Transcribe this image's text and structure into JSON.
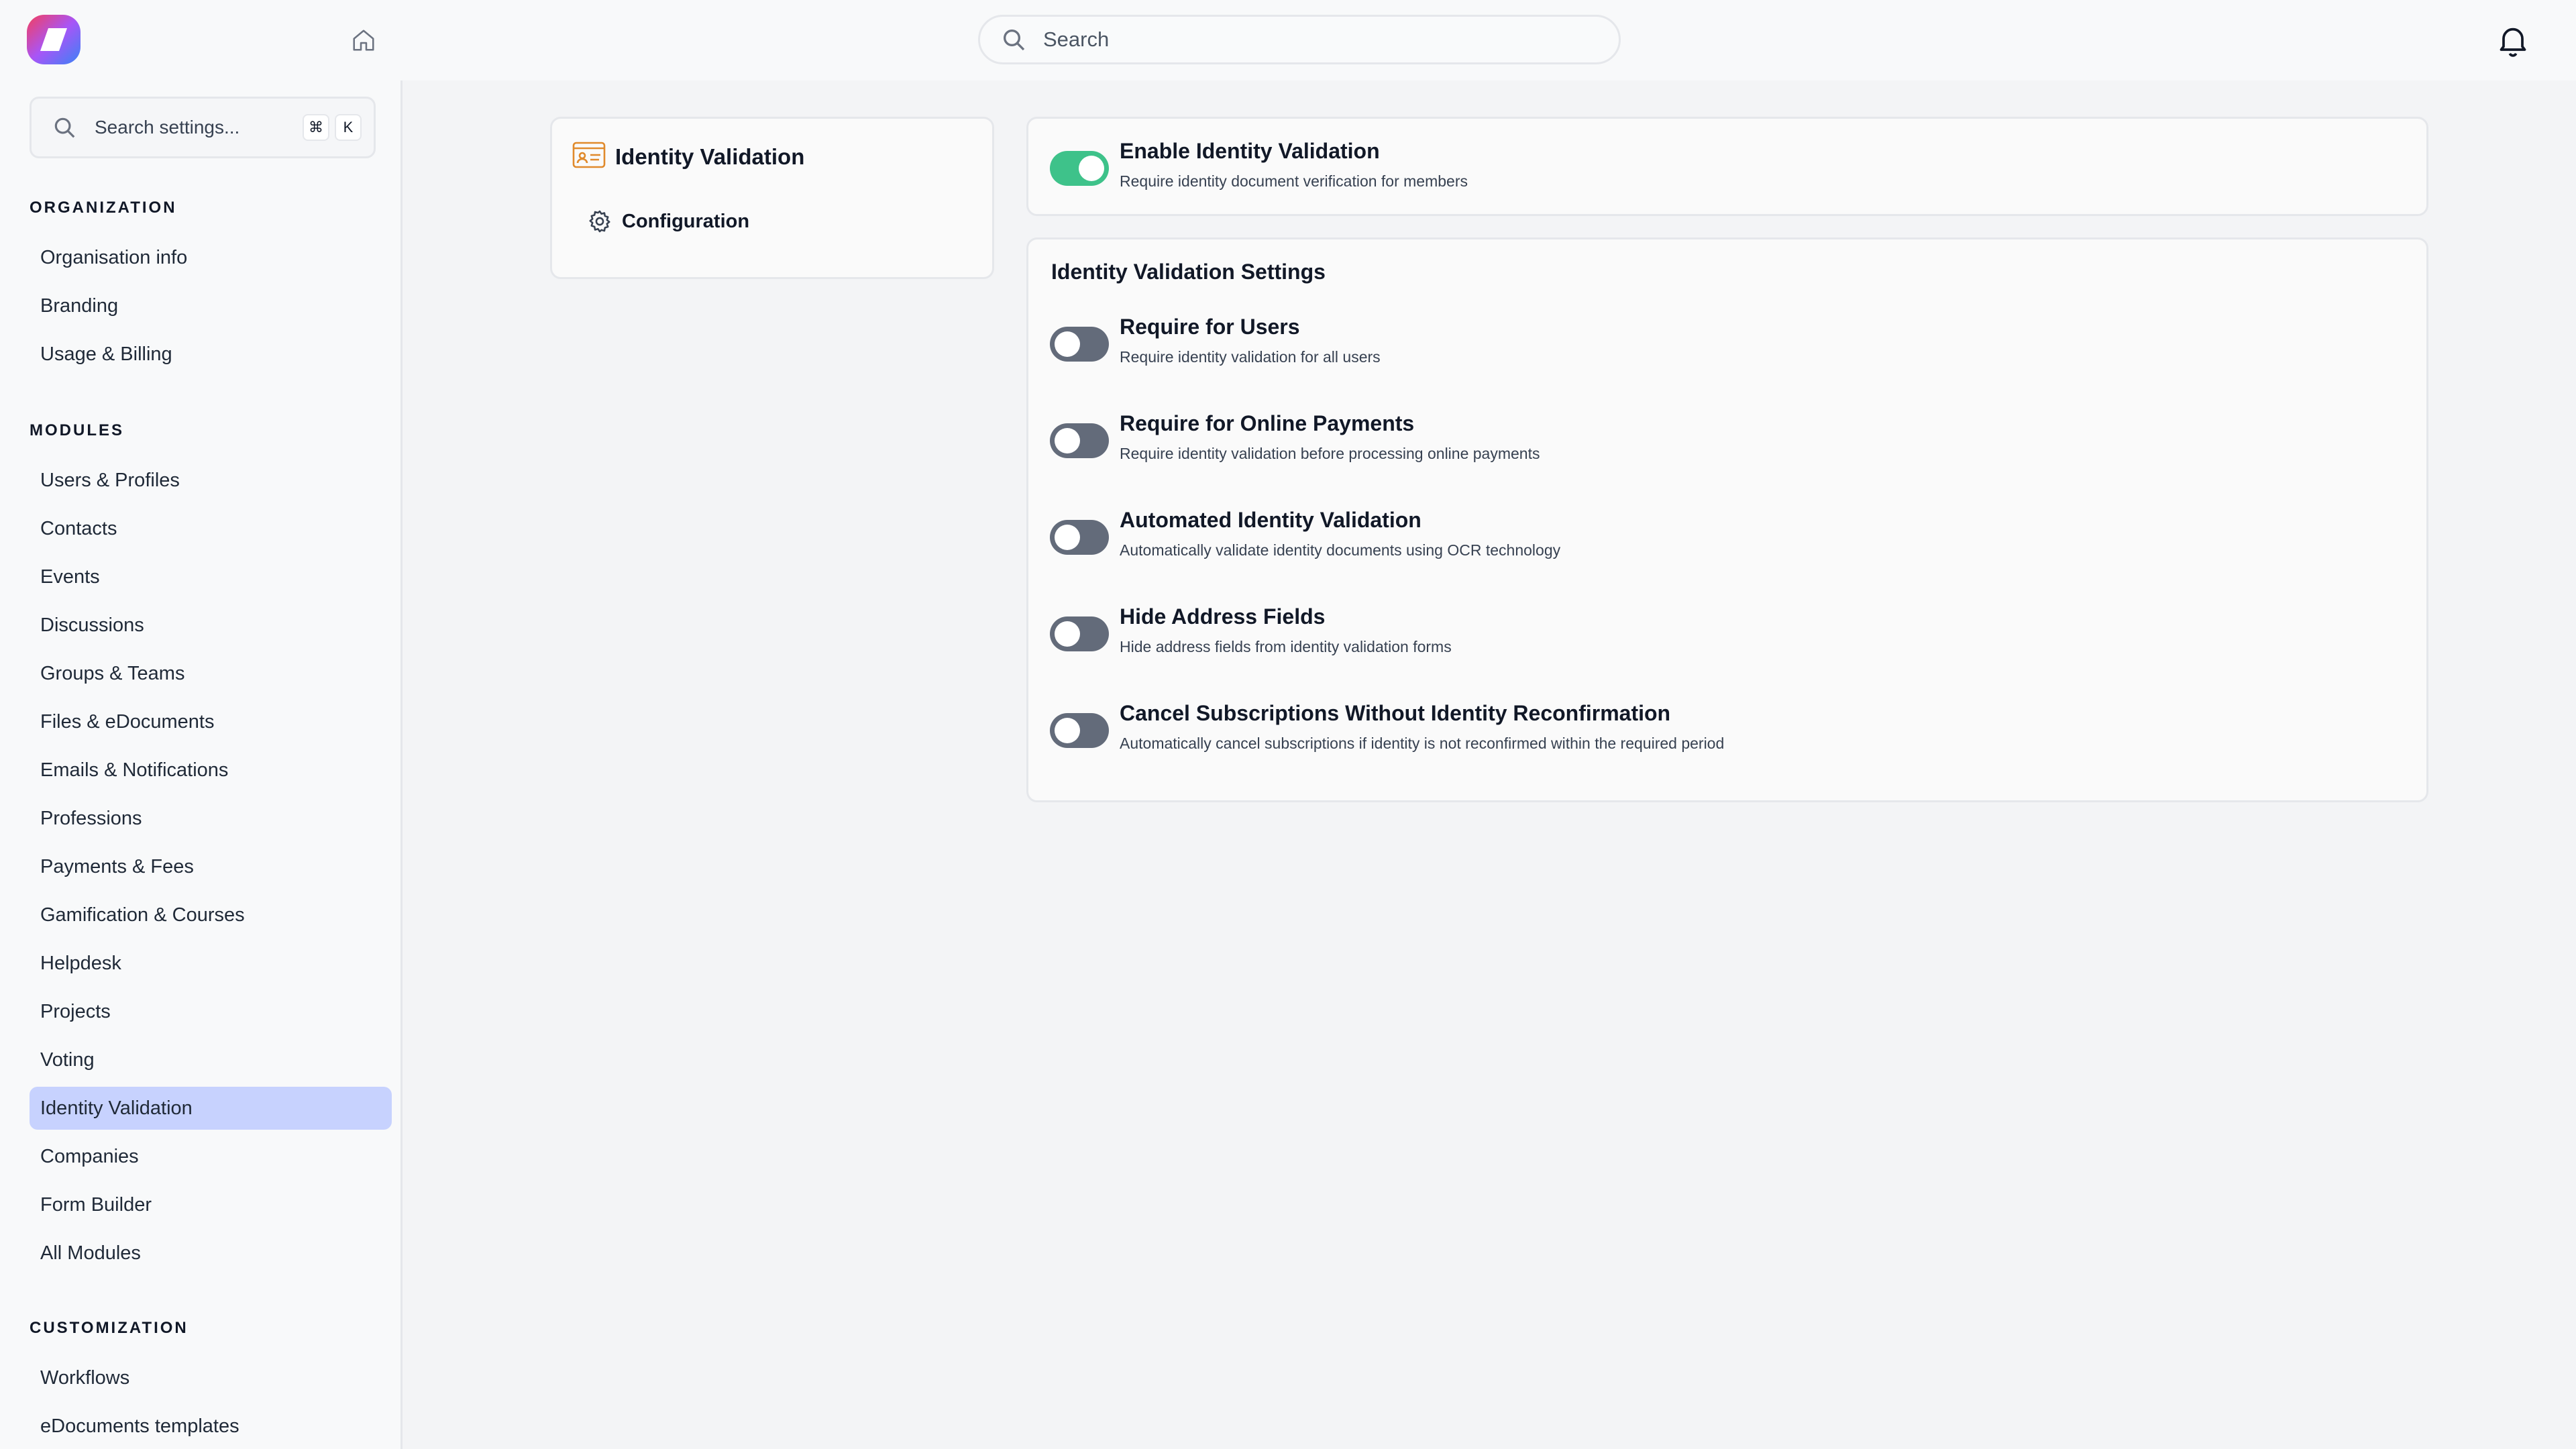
{
  "topbar": {
    "search_placeholder": "Search"
  },
  "sidebar": {
    "search_placeholder": "Search settings...",
    "shortcut": [
      "⌘",
      "K"
    ],
    "sections": [
      {
        "title": "ORGANIZATION",
        "items": [
          "Organisation info",
          "Branding",
          "Usage & Billing"
        ]
      },
      {
        "title": "MODULES",
        "items": [
          "Users & Profiles",
          "Contacts",
          "Events",
          "Discussions",
          "Groups & Teams",
          "Files & eDocuments",
          "Emails & Notifications",
          "Professions",
          "Payments & Fees",
          "Gamification & Courses",
          "Helpdesk",
          "Projects",
          "Voting",
          "Identity Validation",
          "Companies",
          "Form Builder",
          "All Modules"
        ]
      },
      {
        "title": "CUSTOMIZATION",
        "items": [
          "Workflows",
          "eDocuments templates"
        ]
      }
    ],
    "active_item": "Identity Validation"
  },
  "module_card": {
    "title": "Identity Validation",
    "sub_item": "Configuration"
  },
  "enable": {
    "title": "Enable Identity Validation",
    "description": "Require identity document verification for members",
    "enabled": true
  },
  "settings": {
    "heading": "Identity Validation Settings",
    "rows": [
      {
        "title": "Require for Users",
        "description": "Require identity validation for all users",
        "enabled": false
      },
      {
        "title": "Require for Online Payments",
        "description": "Require identity validation before processing online payments",
        "enabled": false
      },
      {
        "title": "Automated Identity Validation",
        "description": "Automatically validate identity documents using OCR technology",
        "enabled": false
      },
      {
        "title": "Hide Address Fields",
        "description": "Hide address fields from identity validation forms",
        "enabled": false
      },
      {
        "title": "Cancel Subscriptions Without Identity Reconfirmation",
        "description": "Automatically cancel subscriptions if identity is not reconfirmed within the required period",
        "enabled": false
      }
    ]
  },
  "colors": {
    "accent_active": "#c7d2fe",
    "toggle_on": "#3ec28a",
    "toggle_off": "#636b7a",
    "module_icon": "#e08a2c"
  }
}
